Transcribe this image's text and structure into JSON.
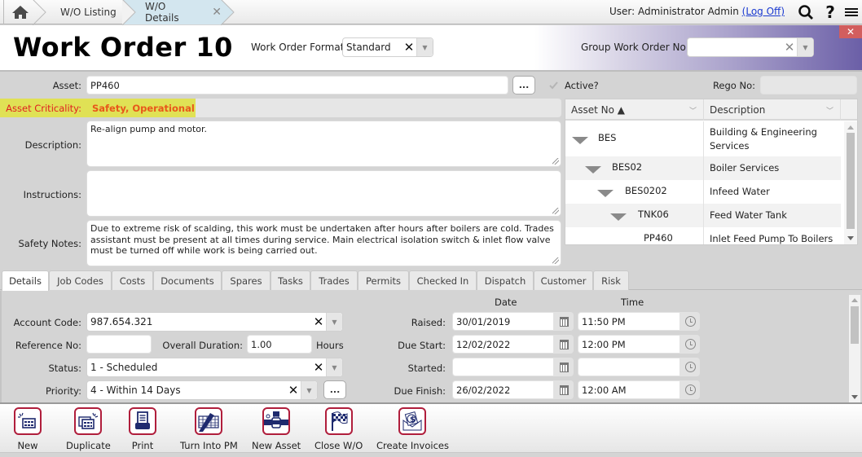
{
  "topbar": {
    "home_icon": "home-icon",
    "breadcrumbs": [
      {
        "label": "W/O Listing"
      },
      {
        "label": "W/O Details",
        "closable": true,
        "close_glyph": "✕"
      }
    ],
    "user_prefix": "User: Administrator Admin",
    "logoff_label": "(Log Off)",
    "icons": [
      "search-icon",
      "help-icon",
      "menu-icon"
    ],
    "help_glyph": "?",
    "menu_glyph": "≡"
  },
  "header": {
    "title": "Work Order 10",
    "format_label": "Work Order Format",
    "format_value": "Standard",
    "group_label": "Group Work Order No:",
    "group_value": "",
    "close_glyph": "✕",
    "clear_glyph": "✕",
    "dropdown_glyph": "▼"
  },
  "form": {
    "asset_label": "Asset:",
    "asset_value": "PP460",
    "lookup_label": "...",
    "active_label": "Active?",
    "active_checked": true,
    "rego_label": "Rego No:",
    "rego_value": "",
    "criticality_label": "Asset Criticality:",
    "criticality_value": "Safety, Operational",
    "description_label": "Description:",
    "description_value": "Re-align pump and motor.",
    "instructions_label": "Instructions:",
    "instructions_value": "",
    "safety_label": "Safety Notes:",
    "safety_value": "Due to extreme risk of scalding, this work must be undertaken after hours after boilers are cold. Trades assistant must be present at all times during service.  Main electrical isolation switch & inlet flow valve must be turned off while work is being carried out."
  },
  "asset_grid": {
    "columns": [
      {
        "label": "Asset No ▲"
      },
      {
        "label": "Description"
      }
    ],
    "chevron": "﹀",
    "rows": [
      {
        "asset_no": "BES",
        "description": "Building & Engineering Services",
        "level": 0,
        "expanded": true
      },
      {
        "asset_no": "BES02",
        "description": "Boiler Services",
        "level": 1,
        "expanded": true
      },
      {
        "asset_no": "BES0202",
        "description": "Infeed Water",
        "level": 2,
        "expanded": true
      },
      {
        "asset_no": "TNK06",
        "description": "Feed Water Tank",
        "level": 3,
        "expanded": true
      },
      {
        "asset_no": "PP460",
        "description": "Inlet Feed Pump To Boilers",
        "level": 4,
        "expanded": false
      }
    ]
  },
  "tabs": [
    {
      "label": "Details",
      "active": true
    },
    {
      "label": "Job Codes"
    },
    {
      "label": "Costs"
    },
    {
      "label": "Documents"
    },
    {
      "label": "Spares"
    },
    {
      "label": "Tasks"
    },
    {
      "label": "Trades"
    },
    {
      "label": "Permits"
    },
    {
      "label": "Checked In"
    },
    {
      "label": "Dispatch"
    },
    {
      "label": "Customer"
    },
    {
      "label": "Risk"
    }
  ],
  "details": {
    "account_code_label": "Account Code:",
    "account_code_value": "987.654.321",
    "reference_label": "Reference No:",
    "reference_value": "",
    "duration_label": "Overall Duration:",
    "duration_value": "1.00",
    "duration_unit": "Hours",
    "status_label": "Status:",
    "status_value": "1 - Scheduled",
    "priority_label": "Priority:",
    "priority_value": "4 - Within 14 Days",
    "priority_more": "...",
    "date_header": "Date",
    "time_header": "Time",
    "dates": [
      {
        "label": "Raised:",
        "date": "30/01/2019",
        "time": "11:50 PM"
      },
      {
        "label": "Due Start:",
        "date": "12/02/2022",
        "time": "12:00 PM"
      },
      {
        "label": "Started:",
        "date": "",
        "time": ""
      },
      {
        "label": "Due Finish:",
        "date": "26/02/2022",
        "time": "12:00 AM"
      }
    ]
  },
  "toolbar": {
    "buttons": [
      {
        "label": "New",
        "icon": "new-icon"
      },
      {
        "label": "Duplicate",
        "icon": "duplicate-icon"
      },
      {
        "label": "Print",
        "icon": "print-icon"
      },
      {
        "label": "Turn Into PM",
        "icon": "turn-into-pm-icon"
      },
      {
        "label": "New Asset",
        "icon": "new-asset-icon"
      },
      {
        "label": "Close W/O",
        "icon": "checkered-flag-icon"
      },
      {
        "label": "Create Invoices",
        "icon": "invoice-icon"
      }
    ]
  },
  "colors": {
    "criticality_highlight": "#e2e33e",
    "criticality_text": "#e8571a",
    "criticality_label": "#e02020",
    "toolbar_icon_border": "#b01e3c",
    "toolbar_icon_fill": "#1e2a6e",
    "header_gradient_end": "#6b5fa7"
  }
}
